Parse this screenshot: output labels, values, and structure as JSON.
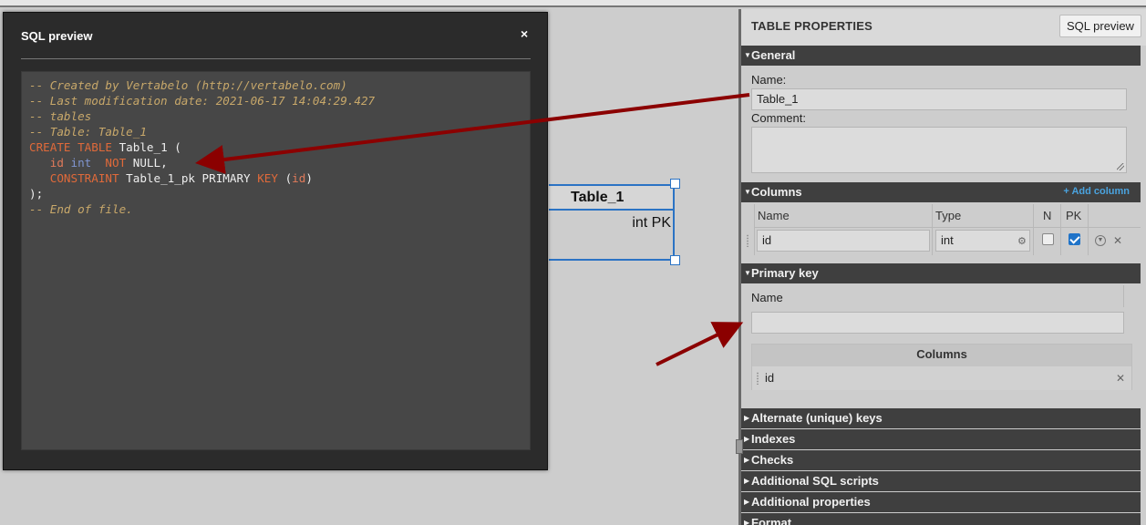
{
  "dialog": {
    "title": "SQL preview",
    "close_label": "×",
    "code_lines": [
      [
        {
          "t": "-- Created by Vertabelo (http://vertabelo.com)",
          "c": "c-cm"
        }
      ],
      [
        {
          "t": "-- Last modification date: 2021-06-17 14:04:29.427",
          "c": "c-cm"
        }
      ],
      [
        {
          "t": "-- tables",
          "c": "c-cm"
        }
      ],
      [
        {
          "t": "-- Table: Table_1",
          "c": "c-cm"
        }
      ],
      [
        {
          "t": "CREATE TABLE ",
          "c": "c-kw"
        },
        {
          "t": "Table_1 (",
          "c": "c-tx"
        }
      ],
      [
        {
          "t": "   id ",
          "c": "c-id"
        },
        {
          "t": "int ",
          "c": "c-ty"
        },
        {
          "t": " NOT ",
          "c": "c-kw"
        },
        {
          "t": "NULL,",
          "c": "c-tx"
        }
      ],
      [
        {
          "t": "   CONSTRAINT ",
          "c": "c-kw"
        },
        {
          "t": "Table_1_pk PRIMARY ",
          "c": "c-tx"
        },
        {
          "t": "KEY ",
          "c": "c-kw"
        },
        {
          "t": "(",
          "c": "c-tx"
        },
        {
          "t": "id",
          "c": "c-id"
        },
        {
          "t": ")",
          "c": "c-tx"
        }
      ],
      [
        {
          "t": ");",
          "c": "c-tx"
        }
      ],
      [
        {
          "t": "-- End of file.",
          "c": "c-cm"
        }
      ]
    ]
  },
  "entity": {
    "title": "Table_1",
    "row": "int PK"
  },
  "panel": {
    "title": "TABLE PROPERTIES",
    "sql_preview_button": "SQL preview",
    "general": {
      "header": "General",
      "name_label": "Name:",
      "name_value": "Table_1",
      "comment_label": "Comment:",
      "comment_value": ""
    },
    "columns": {
      "header": "Columns",
      "add_label": "+ Add column",
      "head_name": "Name",
      "head_type": "Type",
      "head_n": "N",
      "head_pk": "PK",
      "rows": [
        {
          "name": "id",
          "type": "int",
          "nullable": false,
          "pk": true
        }
      ]
    },
    "primary_key": {
      "header": "Primary key",
      "name_label": "Name",
      "name_value": "",
      "columns_header": "Columns",
      "columns": [
        "id"
      ]
    },
    "collapsed_sections": [
      "Alternate (unique) keys",
      "Indexes",
      "Checks",
      "Additional SQL scripts",
      "Additional properties",
      "Format"
    ]
  },
  "colors": {
    "accent_blue": "#2b73c4",
    "arrow_red": "#8b0000",
    "keyword": "#e06a3a",
    "comment": "#c8a86a"
  }
}
